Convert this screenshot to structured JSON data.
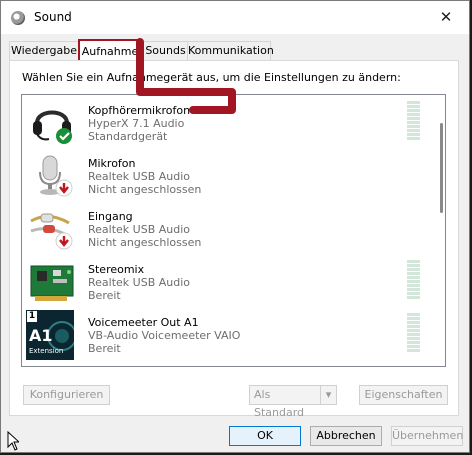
{
  "window": {
    "title": "Sound",
    "close_glyph": "✕"
  },
  "tabs": [
    {
      "label": "Wiedergabe",
      "active": false
    },
    {
      "label": "Aufnahme",
      "active": true
    },
    {
      "label": "Sounds",
      "active": false
    },
    {
      "label": "Kommunikation",
      "active": false
    }
  ],
  "instruction": "Wählen Sie ein Aufnahmegerät aus, um die Einstellungen zu ändern:",
  "devices": [
    {
      "name": "Kopfhörermikrofon",
      "driver": "HyperX 7.1 Audio",
      "status": "Standardgerät",
      "icon": "headset-icon",
      "badge": "green-check"
    },
    {
      "name": "Mikrofon",
      "driver": "Realtek USB Audio",
      "status": "Nicht angeschlossen",
      "icon": "microphone-icon",
      "badge": "red-down-arrow"
    },
    {
      "name": "Eingang",
      "driver": "Realtek USB Audio",
      "status": "Nicht angeschlossen",
      "icon": "rca-cable-icon",
      "badge": "red-down-arrow"
    },
    {
      "name": "Stereomix",
      "driver": "Realtek USB Audio",
      "status": "Bereit",
      "icon": "sound-card-icon",
      "badge": "none"
    },
    {
      "name": "Voicemeeter Out A1",
      "driver": "VB-Audio Voicemeeter VAIO",
      "status": "Bereit",
      "icon": "voicemeeter-a1-icon",
      "badge": "none",
      "icon_text": {
        "top": "1",
        "main": "A1",
        "sub": "Extension"
      }
    }
  ],
  "buttons": {
    "configure": "Konfigurieren",
    "set_default": "Als Standard",
    "properties": "Eigenschaften",
    "ok": "OK",
    "cancel": "Abbrechen",
    "apply": "Übernehmen"
  },
  "colors": {
    "annotation": "#a11622",
    "accent": "#0078d7",
    "meter": "#d2e6d9"
  }
}
